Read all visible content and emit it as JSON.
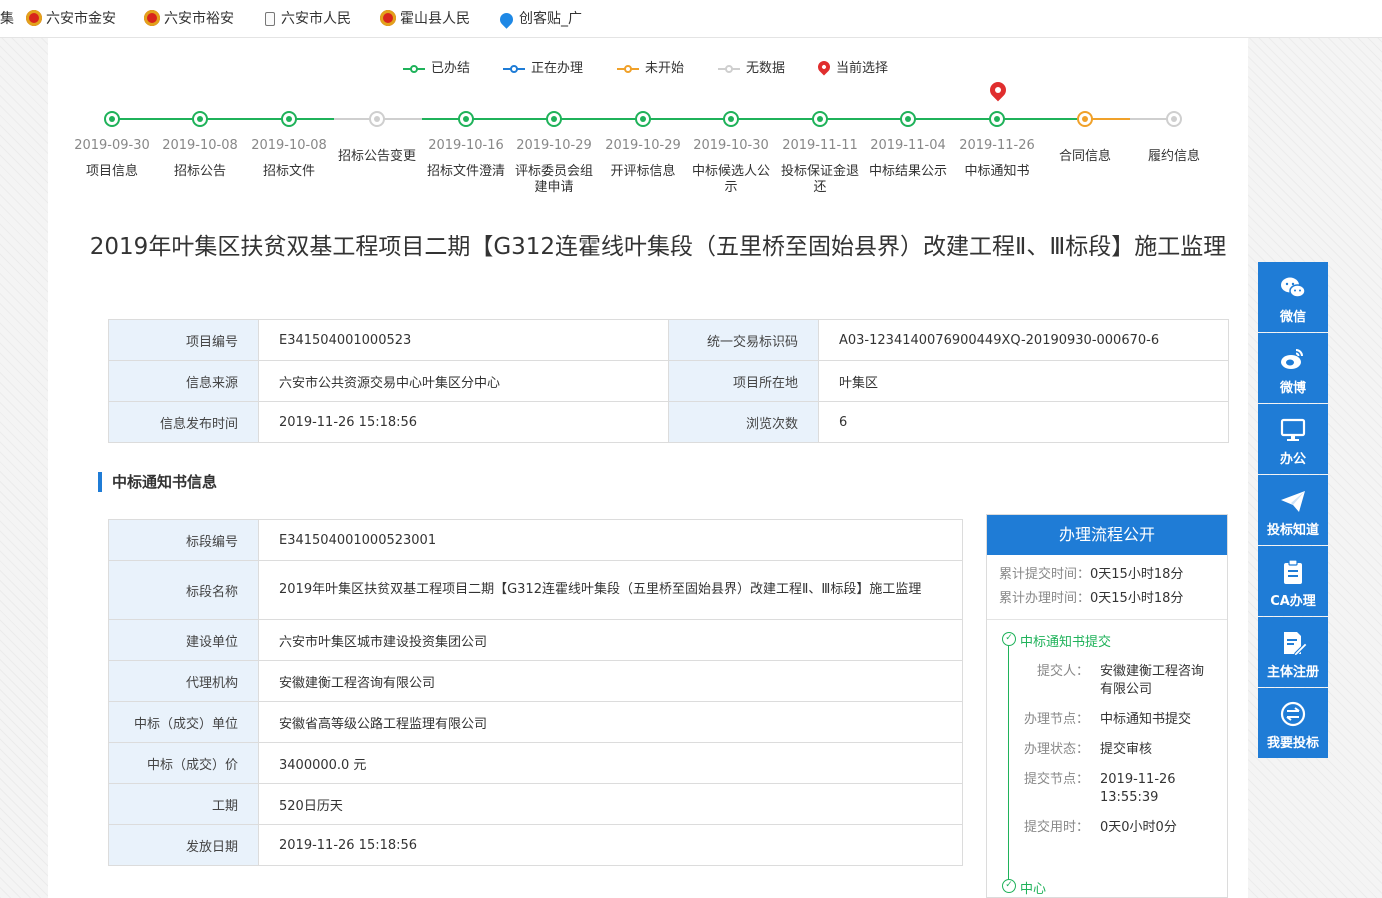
{
  "bookmarks": [
    {
      "label": "集",
      "icon": "none"
    },
    {
      "label": "六安市金安",
      "icon": "emblem-icon"
    },
    {
      "label": "六安市裕安",
      "icon": "emblem-icon"
    },
    {
      "label": "六安市人民",
      "icon": "document-icon"
    },
    {
      "label": "霍山县人民",
      "icon": "emblem-icon"
    },
    {
      "label": "创客贴_广",
      "icon": "blue-drop-icon"
    }
  ],
  "legend": {
    "done": "已办结",
    "in_progress": "正在办理",
    "not_started": "未开始",
    "no_data": "无数据",
    "current": "当前选择"
  },
  "status_colors": {
    "done": "#1fb25a",
    "in_progress": "#1f7cd6",
    "not_started": "#f0a12a",
    "no_data": "#cfcfcf"
  },
  "steps": [
    {
      "date": "2019-09-30",
      "label": "项目信息",
      "status": "done"
    },
    {
      "date": "2019-10-08",
      "label": "招标公告",
      "status": "done"
    },
    {
      "date": "2019-10-08",
      "label": "招标文件",
      "status": "done"
    },
    {
      "date": "",
      "label": "招标公告变更",
      "status": "no_data"
    },
    {
      "date": "2019-10-16",
      "label": "招标文件澄清",
      "status": "done"
    },
    {
      "date": "2019-10-29",
      "label": "评标委员会组建申请",
      "status": "done"
    },
    {
      "date": "2019-10-29",
      "label": "开评标信息",
      "status": "done"
    },
    {
      "date": "2019-10-30",
      "label": "中标候选人公示",
      "status": "done"
    },
    {
      "date": "2019-11-11",
      "label": "投标保证金退还",
      "status": "done"
    },
    {
      "date": "2019-11-04",
      "label": "中标结果公示",
      "status": "done"
    },
    {
      "date": "2019-11-26",
      "label": "中标通知书",
      "status": "done",
      "current": true
    },
    {
      "date": "",
      "label": "合同信息",
      "status": "not_started"
    },
    {
      "date": "",
      "label": "履约信息",
      "status": "no_data"
    }
  ],
  "title": "2019年叶集区扶贫双基工程项目二期【G312连霍线叶集段（五里桥至固始县界）改建工程Ⅱ、Ⅲ标段】施工监理",
  "info": {
    "project_code_label": "项目编号",
    "project_code": "E341504001000523",
    "trade_code_label": "统一交易标识码",
    "trade_code": "A03-1234140076900449XQ-20190930-000670-6",
    "source_label": "信息来源",
    "source": "六安市公共资源交易中心叶集区分中心",
    "location_label": "项目所在地",
    "location": "叶集区",
    "publish_time_label": "信息发布时间",
    "publish_time": "2019-11-26 15:18:56",
    "views_label": "浏览次数",
    "views": "6"
  },
  "section_title": "中标通知书信息",
  "notice": [
    {
      "label": "标段编号",
      "value": "E341504001000523001"
    },
    {
      "label": "标段名称",
      "value": "2019年叶集区扶贫双基工程项目二期【G312连霍线叶集段（五里桥至固始县界）改建工程Ⅱ、Ⅲ标段】施工监理"
    },
    {
      "label": "建设单位",
      "value": "六安市叶集区城市建设投资集团公司"
    },
    {
      "label": "代理机构",
      "value": "安徽建衡工程咨询有限公司"
    },
    {
      "label": "中标（成交）单位",
      "value": "安徽省高等级公路工程监理有限公司"
    },
    {
      "label": "中标（成交）价",
      "value": "3400000.0 元"
    },
    {
      "label": "工期",
      "value": "520日历天"
    },
    {
      "label": "发放日期",
      "value": "2019-11-26 15:18:56"
    }
  ],
  "flow": {
    "title": "办理流程公开",
    "total_submit_label": "累计提交时间：",
    "total_submit": "0天15小时18分",
    "total_handle_label": "累计办理时间：",
    "total_handle": "0天15小时18分",
    "step_name": "中标通知书提交",
    "fields": [
      {
        "key": "提交人：",
        "value": "安徽建衡工程咨询有限公司"
      },
      {
        "key": "办理节点：",
        "value": "中标通知书提交"
      },
      {
        "key": "办理状态：",
        "value": "提交审核"
      },
      {
        "key": "提交节点：",
        "value": "2019-11-26 13:55:39"
      },
      {
        "key": "提交用时：",
        "value": "0天0小时0分"
      }
    ],
    "next_step": "中心"
  },
  "sidebar": [
    {
      "label": "微信",
      "icon": "wechat-icon"
    },
    {
      "label": "微博",
      "icon": "weibo-icon"
    },
    {
      "label": "办公",
      "icon": "monitor-icon"
    },
    {
      "label": "投标知道",
      "icon": "paper-plane-icon"
    },
    {
      "label": "CA办理",
      "icon": "clipboard-icon"
    },
    {
      "label": "主体注册",
      "icon": "edit-document-icon"
    },
    {
      "label": "我要投标",
      "icon": "exchange-icon"
    }
  ]
}
